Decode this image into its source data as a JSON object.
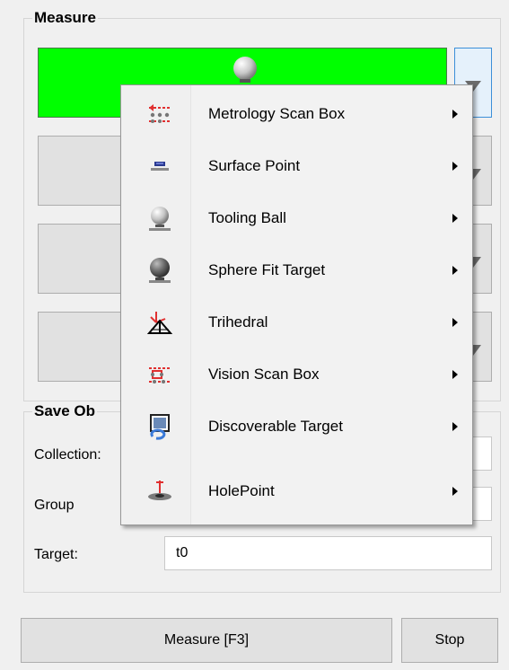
{
  "measure": {
    "title": "Measure",
    "slots": [
      {
        "active": true,
        "icon": "tooling-ball-icon"
      },
      {
        "active": false
      },
      {
        "active": false
      },
      {
        "active": false
      }
    ]
  },
  "save": {
    "title": "Save Ob",
    "fields": [
      {
        "label": "Collection:",
        "value": ""
      },
      {
        "label": "Group",
        "value": ""
      },
      {
        "label": "Target:",
        "value": "t0"
      }
    ]
  },
  "buttons": {
    "measure_label": "Measure [F3]",
    "stop_label": "Stop"
  },
  "menu": {
    "items": [
      {
        "label": "Metrology Scan Box",
        "icon": "metrology-scan-box-icon",
        "has_submenu": true
      },
      {
        "label": "Surface Point",
        "icon": "surface-point-icon",
        "has_submenu": true
      },
      {
        "label": "Tooling Ball",
        "icon": "tooling-ball-icon",
        "has_submenu": true
      },
      {
        "label": "Sphere Fit Target",
        "icon": "sphere-fit-target-icon",
        "has_submenu": true
      },
      {
        "label": "Trihedral",
        "icon": "trihedral-icon",
        "has_submenu": true
      },
      {
        "label": "Vision Scan Box",
        "icon": "vision-scan-box-icon",
        "has_submenu": true
      },
      {
        "label": "Discoverable Target",
        "icon": "discoverable-target-icon",
        "has_submenu": true
      },
      {
        "label": "HolePoint",
        "icon": "holepoint-icon",
        "has_submenu": true
      }
    ]
  },
  "colors": {
    "active_slot": "#00ff00",
    "panel_bg": "#f0f0f0",
    "accent_red": "#e03030"
  }
}
